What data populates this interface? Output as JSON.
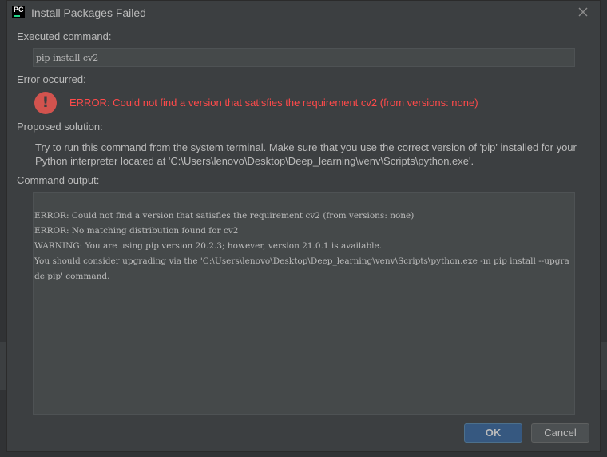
{
  "window": {
    "title": "Install Packages Failed",
    "app_icon_text": "PC"
  },
  "executed_command": {
    "label": "Executed command:",
    "value": "pip install cv2"
  },
  "error_occurred": {
    "label": "Error occurred:",
    "message": "ERROR: Could not find a version that satisfies the requirement cv2 (from versions: none)"
  },
  "proposed_solution": {
    "label": "Proposed solution:",
    "text": "Try to run this command from the system terminal. Make sure that you use the correct version of 'pip' installed for your Python interpreter located at 'C:\\Users\\lenovo\\Desktop\\Deep_learning\\venv\\Scripts\\python.exe'."
  },
  "command_output": {
    "label": "Command output:",
    "lines": [
      "ERROR: Could not find a version that satisfies the requirement cv2 (from versions: none)",
      "ERROR: No matching distribution found for cv2",
      "WARNING: You are using pip version 20.2.3; however, version 21.0.1 is available.",
      "You should consider upgrading via the 'C:\\Users\\lenovo\\Desktop\\Deep_learning\\venv\\Scripts\\python.exe -m pip install --upgrade pip' command."
    ]
  },
  "buttons": {
    "ok": "OK",
    "cancel": "Cancel"
  },
  "icons": {
    "app": "pycharm-icon",
    "close": "close-icon",
    "error": "error-icon"
  },
  "colors": {
    "error_text": "#ff4a4a",
    "error_icon": "#d2534e",
    "ok_button": "#365880"
  }
}
